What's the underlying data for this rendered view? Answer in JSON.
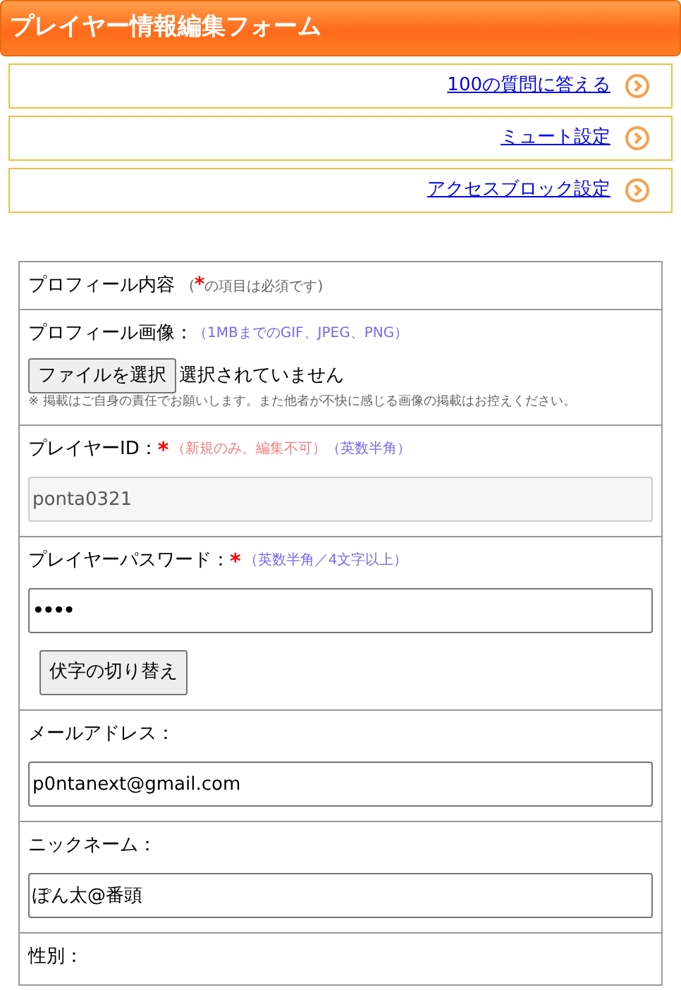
{
  "header": {
    "title": "プレイヤー情報編集フォーム"
  },
  "links": [
    {
      "label": "100の質問に答える"
    },
    {
      "label": "ミュート設定"
    },
    {
      "label": "アクセスブロック設定"
    }
  ],
  "form": {
    "heading": "プロフィール内容",
    "heading_note_open": "(",
    "heading_required_mark": "*",
    "heading_note": "の項目は必須です)",
    "rows": [
      {
        "kind": "file",
        "label": "プロフィール画像：",
        "required": false,
        "notes": [
          {
            "text": "（1MBまでのGIF、JPEG、PNG）",
            "color": "#7b68ee"
          }
        ],
        "button": "ファイルを選択",
        "status": "選択されていません",
        "caption": "※ 掲載はご自身の責任でお願いします。また他者が不快に感じる画像の掲載はお控えください。"
      },
      {
        "kind": "text",
        "label": "プレイヤーID：",
        "required": true,
        "notes": [
          {
            "text": "（新規のみ、編集不可）",
            "color": "#f08080"
          },
          {
            "text": "（英数半角）",
            "color": "#7b68ee"
          }
        ],
        "value": "ponta0321",
        "disabled": true
      },
      {
        "kind": "password",
        "label": "プレイヤーパスワード：",
        "required": true,
        "notes": [
          {
            "text": "（英数半角／4文字以上）",
            "color": "#7b68ee"
          }
        ],
        "value": "••••",
        "disabled": false,
        "button": "伏字の切り替え"
      },
      {
        "kind": "text",
        "label": "メールアドレス：",
        "required": false,
        "notes": [],
        "value": "p0ntanext@gmail.com",
        "disabled": false
      },
      {
        "kind": "text",
        "label": "ニックネーム：",
        "required": false,
        "notes": [],
        "value": "ぽん太@番頭",
        "disabled": false
      },
      {
        "kind": "label",
        "label": "性別：",
        "required": false,
        "notes": []
      }
    ]
  }
}
